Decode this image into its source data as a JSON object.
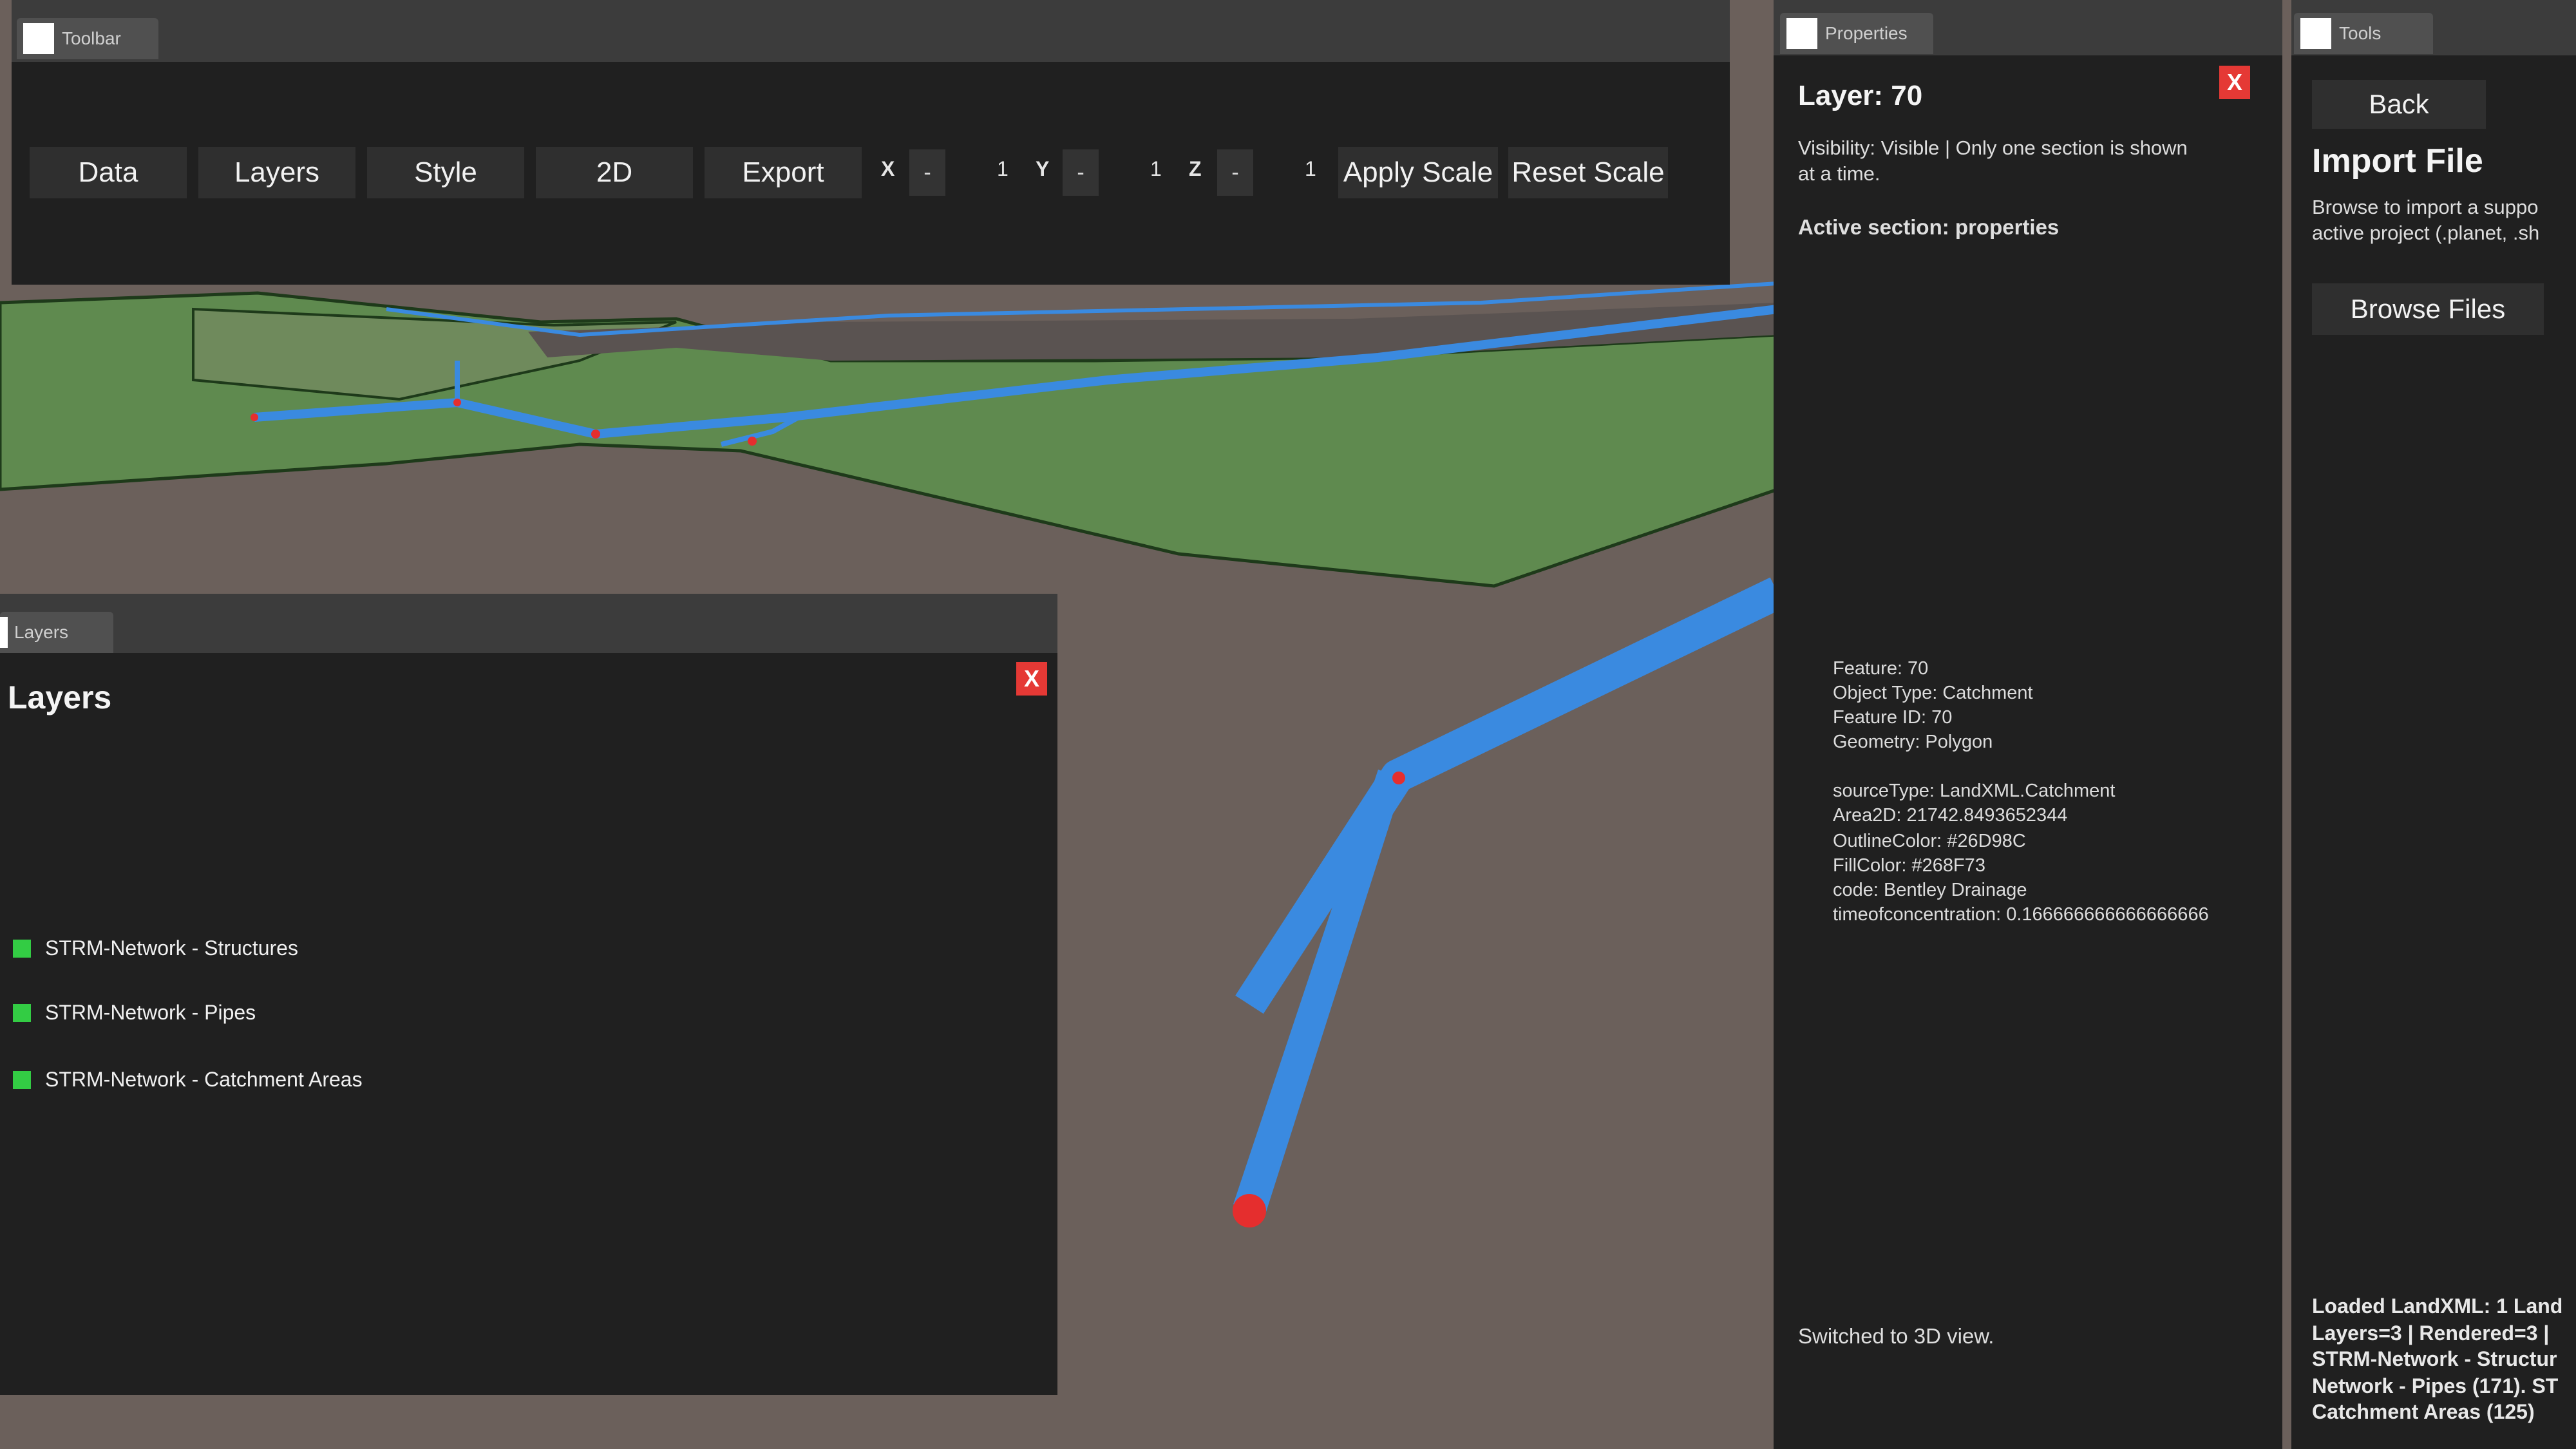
{
  "toolbar": {
    "tab_title": "Toolbar",
    "buttons": {
      "data": "Data",
      "layers": "Layers",
      "style": "Style",
      "view2d": "2D",
      "export": "Export"
    },
    "scale": {
      "x_label": "X",
      "y_label": "Y",
      "z_label": "Z",
      "minus": "-",
      "x_value": "1",
      "y_value": "1",
      "z_value": "1",
      "apply": "Apply Scale",
      "reset": "Reset Scale"
    }
  },
  "layers_panel": {
    "tab_title": "Layers",
    "heading": "Layers",
    "close": "X",
    "items": [
      {
        "label": "STRM-Network - Structures"
      },
      {
        "label": "STRM-Network - Pipes"
      },
      {
        "label": "STRM-Network - Catchment Areas"
      }
    ]
  },
  "properties_panel": {
    "tab_title": "Properties",
    "title": "Layer: 70",
    "close": "X",
    "visibility_line1": "Visibility: Visible | Only one section is shown",
    "visibility_line2": "at a time.",
    "active_section": "Active section: properties",
    "feature_info": [
      "Feature: 70",
      "Object Type: Catchment",
      "Feature ID: 70",
      "Geometry: Polygon"
    ],
    "attributes": [
      "sourceType: LandXML.Catchment",
      "Area2D: 21742.8493652344",
      "OutlineColor: #26D98C",
      "FillColor: #268F73",
      "code: Bentley Drainage",
      "timeofconcentration: 0.166666666666666666"
    ],
    "status": "Switched to 3D view."
  },
  "tools_panel": {
    "tab_title": "Tools",
    "back": "Back",
    "heading": "Import File",
    "description_line1": "Browse to import a suppo",
    "description_line2": "active project (.planet, .sh",
    "browse": "Browse Files",
    "log_lines": [
      "Loaded LandXML: 1 Land",
      "Layers=3 | Rendered=3 |",
      "STRM-Network - Structur",
      "Network - Pipes (171). ST",
      "Catchment Areas (125)"
    ]
  },
  "colors": {
    "terrain": "#5f8a4f",
    "ground": "#6b605b",
    "pipe": "#3a8ae0",
    "structure_node": "#e52e2e",
    "panel_bg": "#202020",
    "close_red": "#e53935",
    "layer_enabled": "#33cc44"
  }
}
